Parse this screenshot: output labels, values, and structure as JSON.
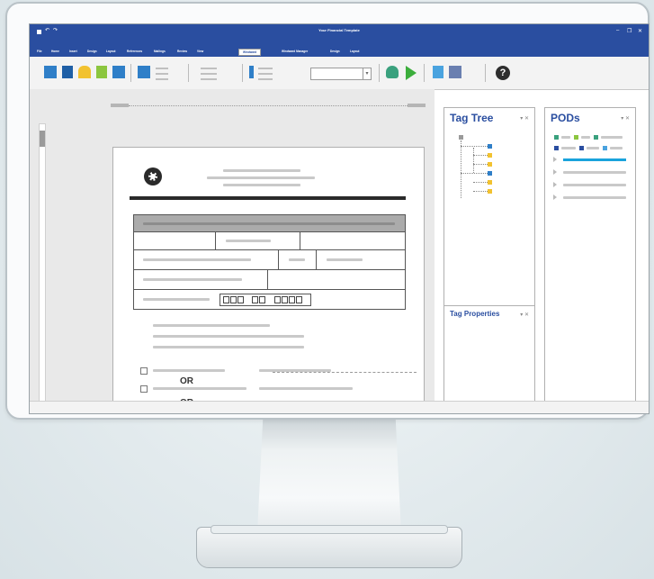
{
  "window": {
    "title": "Your Financial Template"
  },
  "tabs": [
    {
      "label": "File"
    },
    {
      "label": "Home"
    },
    {
      "label": "Insert"
    },
    {
      "label": "Design"
    },
    {
      "label": "Layout"
    },
    {
      "label": "References"
    },
    {
      "label": "Mailings"
    },
    {
      "label": "Review"
    },
    {
      "label": "View"
    },
    {
      "label": "Windward"
    },
    {
      "label": "Windward Manager"
    },
    {
      "label": "Design"
    },
    {
      "label": "Layout"
    }
  ],
  "window_controls": {
    "minimize": "–",
    "restore": "❐",
    "close": "✕"
  },
  "ribbon": {
    "help": "?"
  },
  "document": {
    "or_1": "OR",
    "or_2": "OR"
  },
  "panels": {
    "tag_tree": {
      "title": "Tag Tree"
    },
    "tag_properties": {
      "title": "Tag Properties"
    },
    "pods": {
      "title": "PODs"
    },
    "panel_controls": "▾ ✕"
  },
  "colors": {
    "accent": "#2a4ea0",
    "selection": "#1aa3dc"
  },
  "icons": [
    "save-icon",
    "undo-icon",
    "redo-icon",
    "help-icon",
    "run-icon",
    "wizard-icon"
  ]
}
